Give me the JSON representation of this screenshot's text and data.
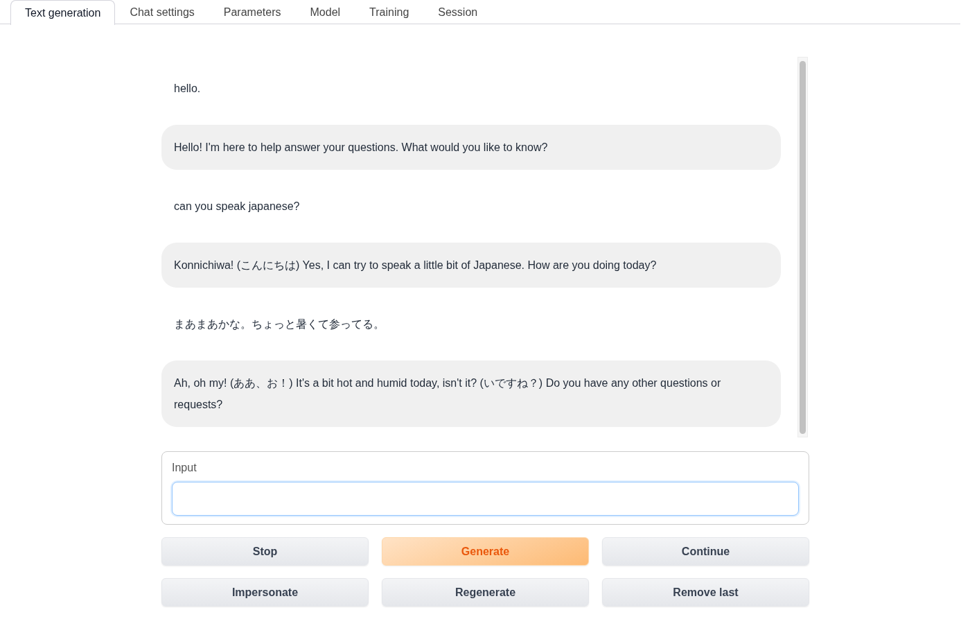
{
  "tabs": [
    {
      "label": "Text generation",
      "selected": true
    },
    {
      "label": "Chat settings",
      "selected": false
    },
    {
      "label": "Parameters",
      "selected": false
    },
    {
      "label": "Model",
      "selected": false
    },
    {
      "label": "Training",
      "selected": false
    },
    {
      "label": "Session",
      "selected": false
    }
  ],
  "chat": {
    "messages": [
      {
        "kind": "user",
        "text": "hello."
      },
      {
        "kind": "bot",
        "text": "Hello! I'm here to help answer your questions. What would you like to know?"
      },
      {
        "kind": "user",
        "text": "can you speak japanese?"
      },
      {
        "kind": "bot",
        "text": "Konnichiwa! (こんにちは) Yes, I can try to speak a little bit of Japanese. How are you doing today?"
      },
      {
        "kind": "user",
        "text": "まあまあかな。ちょっと暑くて参ってる。"
      },
      {
        "kind": "bot",
        "text": "Ah, oh my! (ああ、お！) It's a bit hot and humid today, isn't it? (いですね？) Do you have any other questions or requests?"
      }
    ]
  },
  "input": {
    "label": "Input"
  },
  "buttons": [
    {
      "label": "Stop",
      "kind": "secondary"
    },
    {
      "label": "Generate",
      "kind": "primary"
    },
    {
      "label": "Continue",
      "kind": "secondary"
    },
    {
      "label": "Impersonate",
      "kind": "secondary"
    },
    {
      "label": "Regenerate",
      "kind": "secondary"
    },
    {
      "label": "Remove last",
      "kind": "secondary"
    }
  ]
}
